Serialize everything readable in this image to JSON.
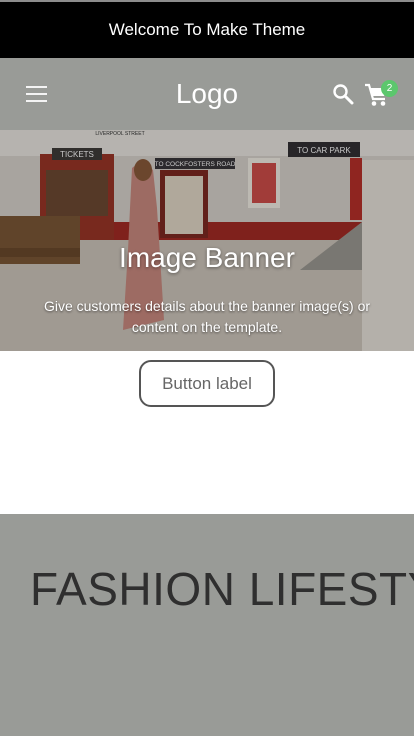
{
  "announcement": {
    "text": "Welcome To Make Theme"
  },
  "header": {
    "logo": "Logo",
    "menu_icon": "hamburger-menu-icon",
    "search_icon": "search-icon",
    "cart_icon": "cart-icon",
    "cart_count": "2"
  },
  "banner": {
    "title": "Image Banner",
    "description": "Give customers details about the banner image(s) or content on the template.",
    "signs": {
      "tickets": "TICKETS",
      "liverpool": "LIVERPOOL STREET",
      "cockfosters": "TO COCKFOSTERS ROAD",
      "car_park": "TO CAR PARK"
    }
  },
  "cta": {
    "label": "Button label"
  },
  "fashion": {
    "title": "FASHION LIFESTYLE"
  },
  "colors": {
    "announcement_bg": "#000000",
    "header_bg": "#999b97",
    "badge": "#5cc76d",
    "section_bg": "#999b97"
  }
}
